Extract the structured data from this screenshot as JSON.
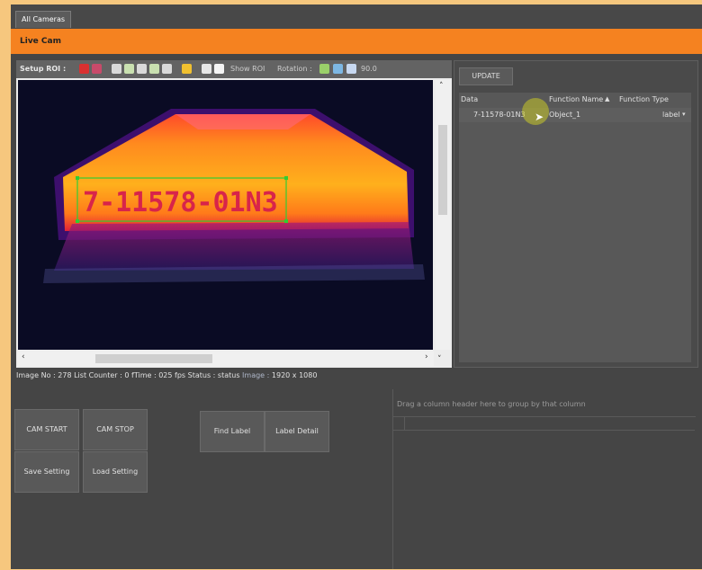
{
  "tabs": [
    {
      "label": "All Cameras"
    }
  ],
  "panel_title": "Live Cam",
  "toolbar": {
    "setup_roi_label": "Setup ROI :",
    "show_roi_label": "Show ROI",
    "rotation_label": "Rotation :",
    "rotation_value": "90.0"
  },
  "camera": {
    "label_text": "7-11578-01N3"
  },
  "status": {
    "image_no_label": "Image No :",
    "image_no": "278",
    "list_counter_label": "List Counter :",
    "list_counter": "0",
    "ftime_label": "fTime :",
    "ftime": "025 fps",
    "status_label": "Status :",
    "status": "status",
    "image_label": "Image :",
    "image_size": "1920 x 1080"
  },
  "right_panel": {
    "update_label": "UPDATE",
    "columns": [
      "Data",
      "Function Name",
      "Function Type"
    ],
    "rows": [
      {
        "data": "7-11578-01N3",
        "function_name": "Object_1",
        "function_type": "label"
      }
    ]
  },
  "buttons": {
    "cam_start": "CAM START",
    "cam_stop": "CAM STOP",
    "find_label": "Find Label",
    "label_detail": "Label Detail",
    "save_setting": "Save Setting",
    "load_setting": "Load Setting"
  },
  "bottom_grid": {
    "group_hint": "Drag a column header here to group by that column"
  },
  "colors": {
    "accent": "#f58220",
    "window_bg": "#454545",
    "desktop_bg": "#f6c77e"
  }
}
